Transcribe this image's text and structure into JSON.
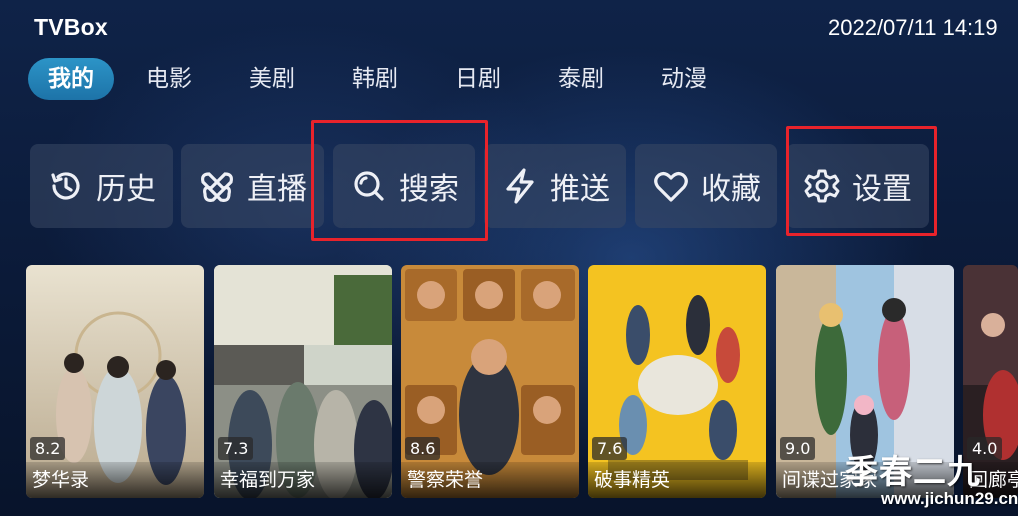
{
  "app": {
    "title": "TVBox",
    "datetime": "2022/07/11 14:19"
  },
  "tabs": [
    {
      "label": "我的",
      "active": true
    },
    {
      "label": "电影",
      "active": false
    },
    {
      "label": "美剧",
      "active": false
    },
    {
      "label": "韩剧",
      "active": false
    },
    {
      "label": "日剧",
      "active": false
    },
    {
      "label": "泰剧",
      "active": false
    },
    {
      "label": "动漫",
      "active": false
    }
  ],
  "actions": [
    {
      "label": "历史",
      "icon": "history-icon"
    },
    {
      "label": "直播",
      "icon": "live-icon"
    },
    {
      "label": "搜索",
      "icon": "search-icon",
      "highlighted": true
    },
    {
      "label": "推送",
      "icon": "push-icon"
    },
    {
      "label": "收藏",
      "icon": "heart-icon"
    },
    {
      "label": "设置",
      "icon": "gear-icon",
      "highlighted": true
    }
  ],
  "posters": [
    {
      "title": "梦华录",
      "rating": "8.2"
    },
    {
      "title": "幸福到万家",
      "rating": "7.3"
    },
    {
      "title": "警察荣誉",
      "rating": "8.6"
    },
    {
      "title": "破事精英",
      "rating": "7.6"
    },
    {
      "title": "间谍过家家",
      "rating": "9.0"
    },
    {
      "title": "回廊亭",
      "rating": "4.0"
    }
  ],
  "watermark": {
    "text": "季春二九",
    "url": "www.jichun29.cn"
  },
  "colors": {
    "accent": "#1d73a8",
    "highlight_box": "#e8232b",
    "background": "#0b1a38",
    "button_bg": "#3a4864"
  }
}
